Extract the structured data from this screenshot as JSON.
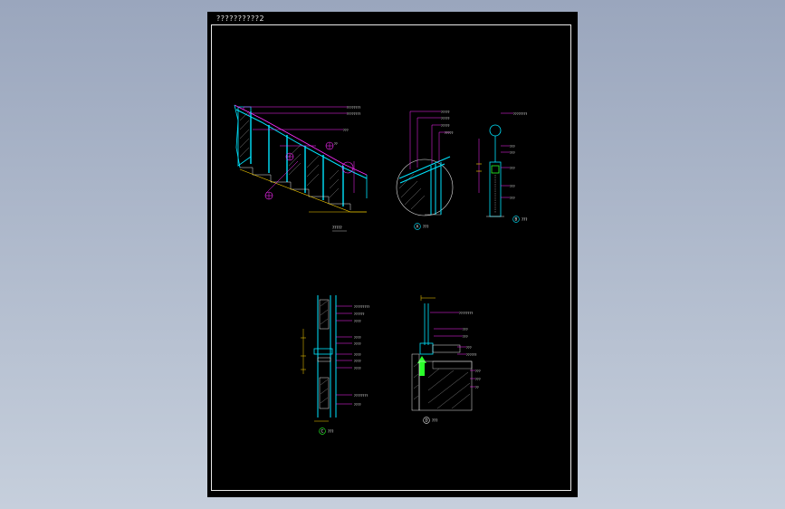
{
  "sheet": {
    "title": "??????????2"
  },
  "colors": {
    "background_top": "#9aa6bd",
    "background_bottom": "#c6cfdc",
    "sheet": "#000000",
    "frame": "#e8e8e8",
    "cyan": "#00e5ff",
    "magenta": "#ff2bff",
    "yellow": "#ffd400",
    "green": "#2aff2a",
    "white": "#ffffff"
  },
  "views": {
    "elevation": {
      "caption": "?????"
    },
    "detail_a": {
      "caption": "???",
      "mark": "A"
    },
    "detail_b": {
      "caption": "???",
      "mark": "B"
    },
    "detail_c": {
      "caption": "???",
      "mark": "C"
    },
    "detail_d": {
      "caption": "???",
      "mark": "D"
    }
  },
  "callouts": {
    "elevation": [
      "????????",
      "????????",
      "???",
      "??"
    ],
    "detail_a": [
      "?????",
      "?????",
      "?????",
      "?????"
    ],
    "detail_b": [
      "????????",
      "???",
      "???",
      "???",
      "???",
      "???"
    ],
    "detail_c": [
      "?????????",
      "??????",
      "????",
      "????",
      "????",
      "????",
      "????",
      "????",
      "????????",
      "????"
    ],
    "detail_d": [
      "????????",
      "???",
      "???",
      "???",
      "??????",
      "???",
      "???",
      "??"
    ]
  }
}
